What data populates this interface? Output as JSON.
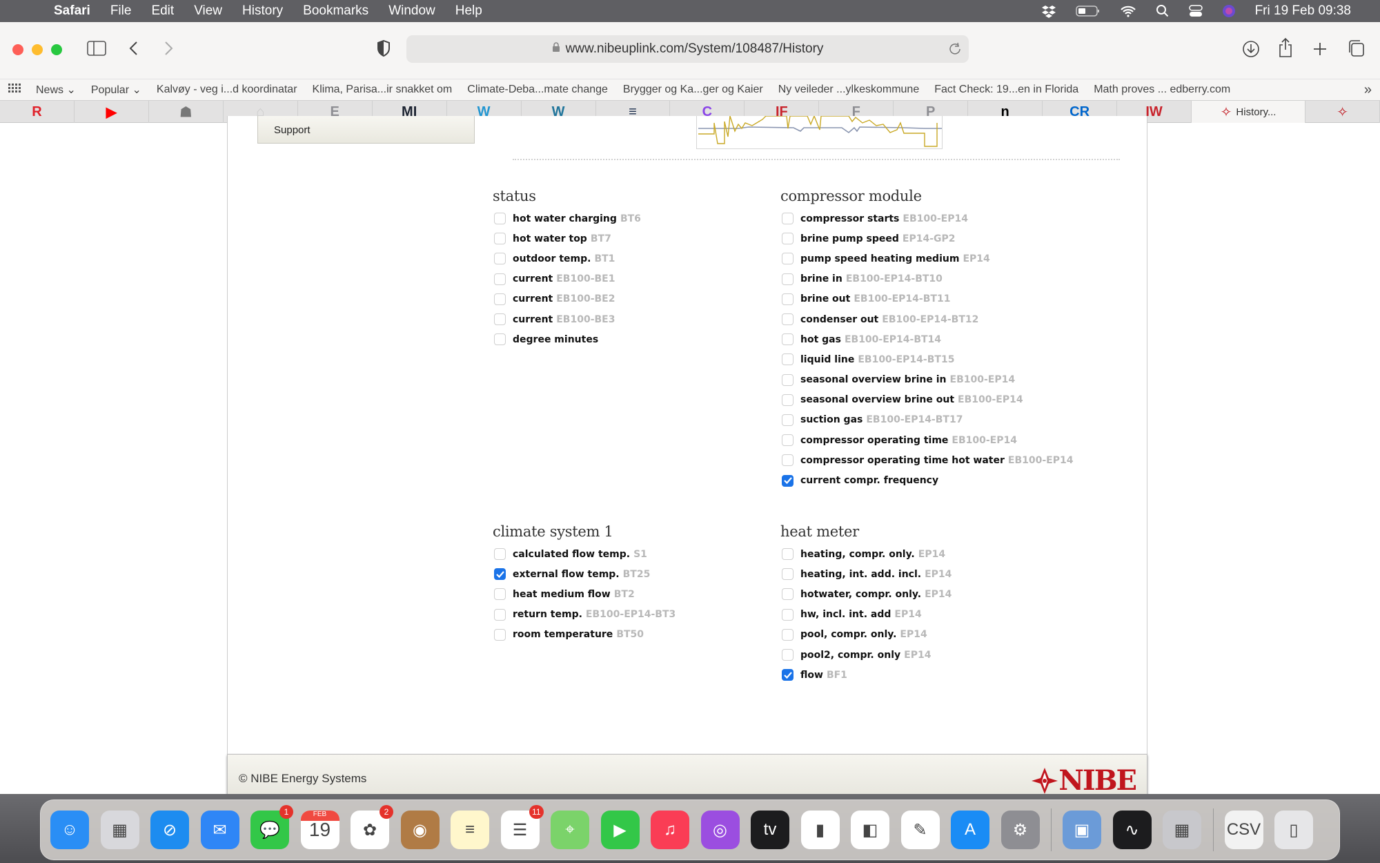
{
  "menubar": {
    "app_name": "Safari",
    "items": [
      "File",
      "Edit",
      "View",
      "History",
      "Bookmarks",
      "Window",
      "Help"
    ],
    "clock": "Fri 19 Feb  09:38"
  },
  "browser": {
    "url": "www.nibeuplink.com/System/108487/History",
    "bookmarks": [
      "News",
      "Popular",
      "Kalvøy - veg i...d koordinatar",
      "Klima, Parisa...ir snakket om",
      "Climate-Deba...mate change",
      "Brygger og Ka...ger og Kaier",
      "Ny veileder ...ylkeskommune",
      "Fact Check: 19...en in Florida",
      "Math proves ... edberry.com"
    ],
    "tabs": [
      {
        "icon": "R",
        "color": "#e0212a",
        "name": "tab-r"
      },
      {
        "icon": "▶",
        "color": "#ff0000",
        "name": "tab-youtube"
      },
      {
        "icon": "☗",
        "color": "#777",
        "name": "tab-drawing"
      },
      {
        "icon": "⌂",
        "color": "#ccc",
        "name": "tab-t"
      },
      {
        "icon": "E",
        "color": "#8e8e93",
        "name": "tab-e"
      },
      {
        "icon": "MI",
        "color": "#1c2331",
        "name": "tab-mi"
      },
      {
        "icon": "W",
        "color": "#2396d1",
        "name": "tab-wordpress-1"
      },
      {
        "icon": "W",
        "color": "#21759b",
        "name": "tab-wordpress-2"
      },
      {
        "icon": "≡",
        "color": "#1b2e4d",
        "name": "tab-lines"
      },
      {
        "icon": "C",
        "color": "#8a44e8",
        "name": "tab-c"
      },
      {
        "icon": "IF",
        "color": "#c8232c",
        "name": "tab-if"
      },
      {
        "icon": "F",
        "color": "#8e8e93",
        "name": "tab-f"
      },
      {
        "icon": "P",
        "color": "#8e8e93",
        "name": "tab-p"
      },
      {
        "icon": "n",
        "color": "#000",
        "name": "tab-n"
      },
      {
        "icon": "CR",
        "color": "#0066cc",
        "name": "tab-cr"
      },
      {
        "icon": "IW",
        "color": "#c8232c",
        "name": "tab-iw"
      }
    ],
    "active_tab": "History...",
    "brand_color": "#c0151d"
  },
  "page": {
    "support_label": "Support",
    "groups": {
      "status": {
        "title": "status",
        "items": [
          {
            "label": "hot water charging",
            "code": "BT6",
            "checked": false
          },
          {
            "label": "hot water top",
            "code": "BT7",
            "checked": false
          },
          {
            "label": "outdoor temp.",
            "code": "BT1",
            "checked": false
          },
          {
            "label": "current",
            "code": "EB100-BE1",
            "checked": false
          },
          {
            "label": "current",
            "code": "EB100-BE2",
            "checked": false
          },
          {
            "label": "current",
            "code": "EB100-BE3",
            "checked": false
          },
          {
            "label": "degree minutes",
            "code": "",
            "checked": false
          }
        ]
      },
      "compressor": {
        "title": "compressor module",
        "items": [
          {
            "label": "compressor starts",
            "code": "EB100-EP14",
            "checked": false
          },
          {
            "label": "brine pump speed",
            "code": "EP14-GP2",
            "checked": false
          },
          {
            "label": "pump speed heating medium",
            "code": "EP14",
            "checked": false
          },
          {
            "label": "brine in",
            "code": "EB100-EP14-BT10",
            "checked": false
          },
          {
            "label": "brine out",
            "code": "EB100-EP14-BT11",
            "checked": false
          },
          {
            "label": "condenser out",
            "code": "EB100-EP14-BT12",
            "checked": false
          },
          {
            "label": "hot gas",
            "code": "EB100-EP14-BT14",
            "checked": false
          },
          {
            "label": "liquid line",
            "code": "EB100-EP14-BT15",
            "checked": false
          },
          {
            "label": "seasonal overview brine in",
            "code": "EB100-EP14",
            "checked": false
          },
          {
            "label": "seasonal overview brine out",
            "code": "EB100-EP14",
            "checked": false
          },
          {
            "label": "suction gas",
            "code": "EB100-EP14-BT17",
            "checked": false
          },
          {
            "label": "compressor operating time",
            "code": "EB100-EP14",
            "checked": false
          },
          {
            "label": "compressor operating time hot water",
            "code": "EB100-EP14",
            "checked": false
          },
          {
            "label": "current compr. frequency",
            "code": "",
            "checked": true
          }
        ]
      },
      "climate": {
        "title": "climate system 1",
        "items": [
          {
            "label": "calculated flow temp.",
            "code": "S1",
            "checked": false
          },
          {
            "label": "external flow temp.",
            "code": "BT25",
            "checked": true
          },
          {
            "label": "heat medium flow",
            "code": "BT2",
            "checked": false
          },
          {
            "label": "return temp.",
            "code": "EB100-EP14-BT3",
            "checked": false
          },
          {
            "label": "room temperature",
            "code": "BT50",
            "checked": false
          }
        ]
      },
      "heatmeter": {
        "title": "heat meter",
        "items": [
          {
            "label": "heating, compr. only.",
            "code": "EP14",
            "checked": false
          },
          {
            "label": "heating, int. add. incl.",
            "code": "EP14",
            "checked": false
          },
          {
            "label": "hotwater, compr. only.",
            "code": "EP14",
            "checked": false
          },
          {
            "label": "hw, incl. int. add",
            "code": "EP14",
            "checked": false
          },
          {
            "label": "pool, compr. only.",
            "code": "EP14",
            "checked": false
          },
          {
            "label": "pool2, compr. only",
            "code": "EP14",
            "checked": false
          },
          {
            "label": "flow",
            "code": "BF1",
            "checked": true
          }
        ]
      }
    },
    "footer_text": "© NIBE Energy Systems",
    "logo_text": "NIBE"
  },
  "dock": {
    "apps": [
      {
        "name": "finder",
        "glyph": "☺",
        "bg": "#2a8ef5"
      },
      {
        "name": "launchpad",
        "glyph": "▦",
        "bg": "#d8d8dc"
      },
      {
        "name": "safari",
        "glyph": "⊘",
        "bg": "#1d8cf0"
      },
      {
        "name": "mail",
        "glyph": "✉",
        "bg": "#2f86f6"
      },
      {
        "name": "messages",
        "glyph": "💬",
        "bg": "#33c748",
        "badge": "1"
      },
      {
        "name": "calendar",
        "glyph": "19",
        "bg": "#ffffff",
        "badge": ""
      },
      {
        "name": "photos",
        "glyph": "✿",
        "bg": "#ffffff",
        "badge": "2"
      },
      {
        "name": "contacts",
        "glyph": "◉",
        "bg": "#b07b45"
      },
      {
        "name": "notes",
        "glyph": "≡",
        "bg": "#fff7cc"
      },
      {
        "name": "reminders",
        "glyph": "☰",
        "bg": "#ffffff",
        "badge": "11"
      },
      {
        "name": "maps",
        "glyph": "⌖",
        "bg": "#7bd36a"
      },
      {
        "name": "facetime",
        "glyph": "▶",
        "bg": "#33c748"
      },
      {
        "name": "music",
        "glyph": "♫",
        "bg": "#fa3d55"
      },
      {
        "name": "podcasts",
        "glyph": "◎",
        "bg": "#9b4ee0"
      },
      {
        "name": "apple-tv",
        "glyph": "tv",
        "bg": "#1c1c1e"
      },
      {
        "name": "numbers",
        "glyph": "▮",
        "bg": "#ffffff"
      },
      {
        "name": "keynote",
        "glyph": "◧",
        "bg": "#ffffff"
      },
      {
        "name": "pages",
        "glyph": "✎",
        "bg": "#ffffff"
      },
      {
        "name": "app-store",
        "glyph": "A",
        "bg": "#1a8cf5"
      },
      {
        "name": "system-preferences",
        "glyph": "⚙",
        "bg": "#8e8e93"
      },
      {
        "name": "preview",
        "glyph": "▣",
        "bg": "#6b9bd8"
      },
      {
        "name": "activity-monitor",
        "glyph": "∿",
        "bg": "#1c1c1e"
      },
      {
        "name": "calculator",
        "glyph": "▦",
        "bg": "#c8c8cc"
      },
      {
        "name": "csv-file",
        "glyph": "CSV",
        "bg": "#f2f2f2"
      },
      {
        "name": "trash",
        "glyph": "▯",
        "bg": "#e6e6e8"
      }
    ],
    "calendar_month": "FEB"
  }
}
